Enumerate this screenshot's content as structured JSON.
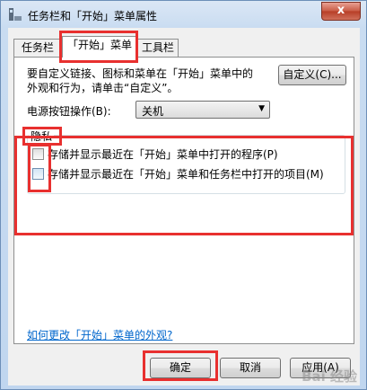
{
  "window": {
    "title": "任务栏和「开始」菜单属性",
    "close_label": "x"
  },
  "tabs": [
    {
      "label": "任务栏"
    },
    {
      "label": "「开始」菜单",
      "active": true
    },
    {
      "label": "工具栏"
    }
  ],
  "start_menu": {
    "description_line1": "要自定义链接、图标和菜单在「开始」菜单中的",
    "description_line2": "外观和行为，请单击“自定义”。",
    "customize_button": "自定义(C)...",
    "power_label": "电源按钮操作(B):",
    "power_value": "关机"
  },
  "privacy": {
    "title": "隐私",
    "items": [
      {
        "label": "存储并显示最近在「开始」菜单中打开的程序(P)",
        "checked": false
      },
      {
        "label": "存储并显示最近在「开始」菜单和任务栏中打开的项目(M)",
        "checked": false
      }
    ]
  },
  "help_link": "如何更改「开始」菜单的外观?",
  "buttons": {
    "ok": "确定",
    "cancel": "取消",
    "apply": "应用(A)"
  },
  "watermark": "Bai 经验",
  "annotation_color": "#e8302f"
}
